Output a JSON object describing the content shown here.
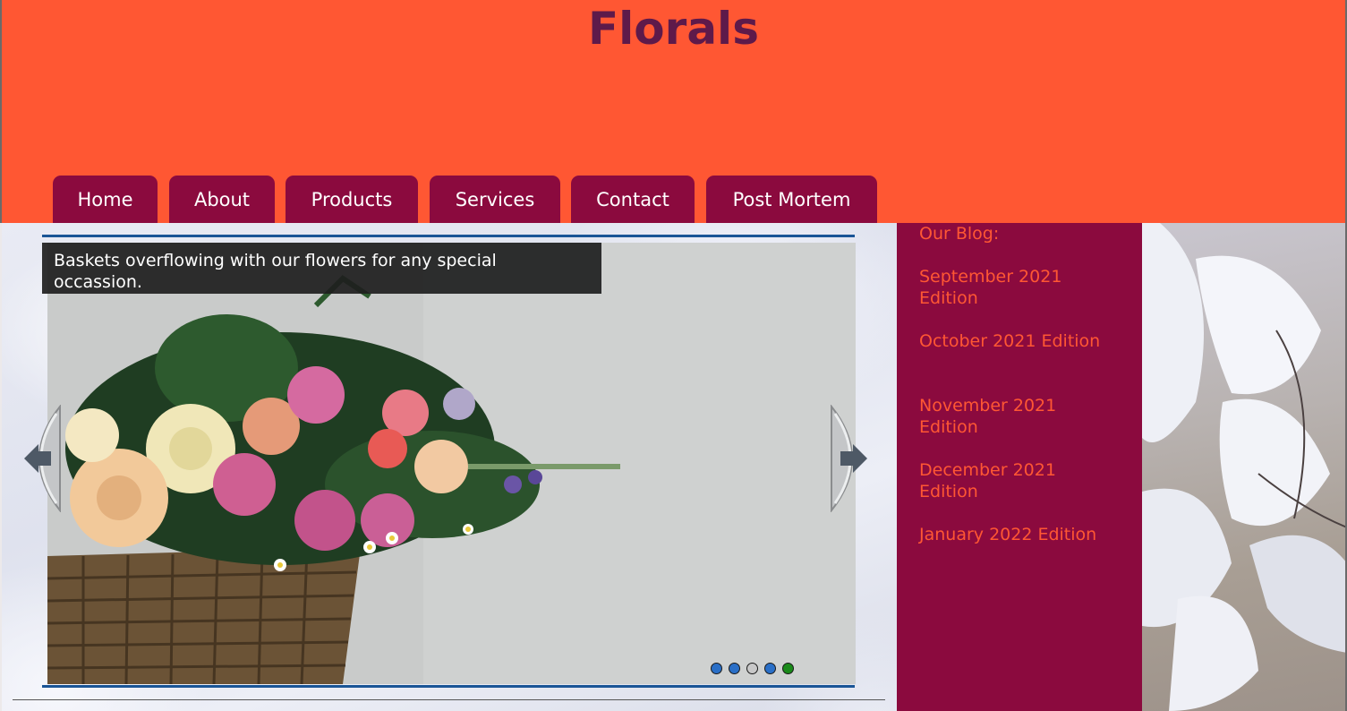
{
  "site": {
    "title": "Florals"
  },
  "nav": {
    "items": [
      {
        "label": "Home"
      },
      {
        "label": "About"
      },
      {
        "label": "Products"
      },
      {
        "label": "Services"
      },
      {
        "label": "Contact"
      },
      {
        "label": "Post Mortem"
      }
    ]
  },
  "slider": {
    "caption": "Baskets overflowing with our flowers for any special occassion.",
    "dots": [
      {
        "color": "#2a6fc7"
      },
      {
        "color": "#2a6fc7"
      },
      {
        "color": "#c8c8c8"
      },
      {
        "color": "#2a6fc7"
      },
      {
        "color": "#1a8a1a"
      }
    ],
    "active_dot": 5
  },
  "sidebar": {
    "heading": "Our Blog:",
    "links": [
      {
        "label": "September 2021 Edition"
      },
      {
        "label": "October 2021 Edition"
      },
      {
        "label": "November 2021 Edition"
      },
      {
        "label": "December 2021 Edition"
      },
      {
        "label": "January 2022 Edition"
      }
    ]
  },
  "colors": {
    "header_bg": "#ff5733",
    "title": "#5e1a4a",
    "nav_tab": "#8b0a3e",
    "sidebar_bg": "#8b0a3e",
    "sidebar_text": "#ff5733",
    "slider_border": "#1a5596"
  }
}
